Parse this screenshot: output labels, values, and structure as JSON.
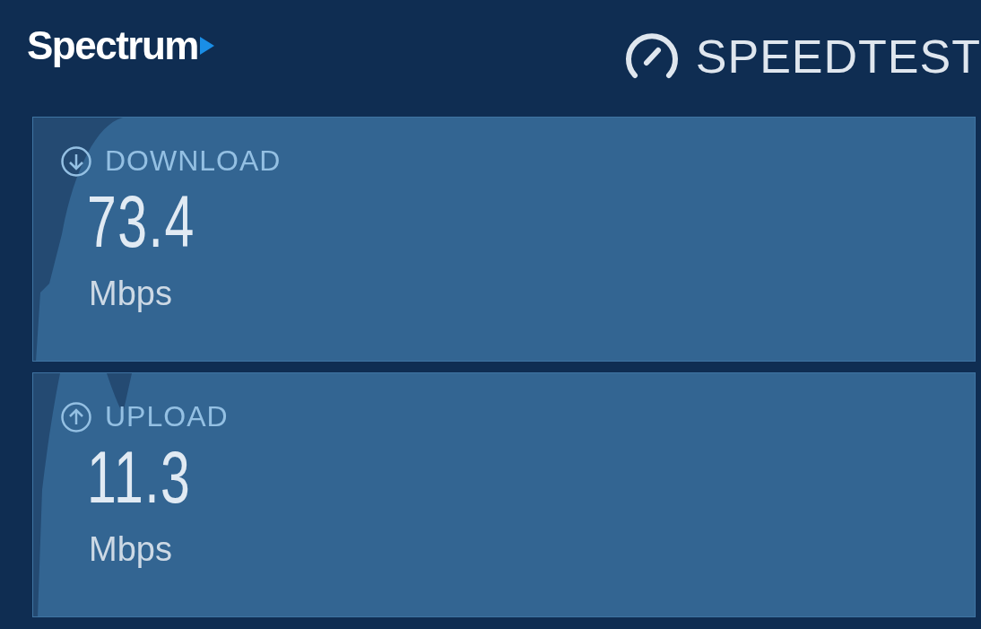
{
  "header": {
    "logo": "Spectrum",
    "title": "SPEEDTEST"
  },
  "results": [
    {
      "kind": "download",
      "label": "DOWNLOAD",
      "value": "73.4",
      "unit": "Mbps"
    },
    {
      "kind": "upload",
      "label": "UPLOAD",
      "value": "11.3",
      "unit": "Mbps"
    }
  ]
}
